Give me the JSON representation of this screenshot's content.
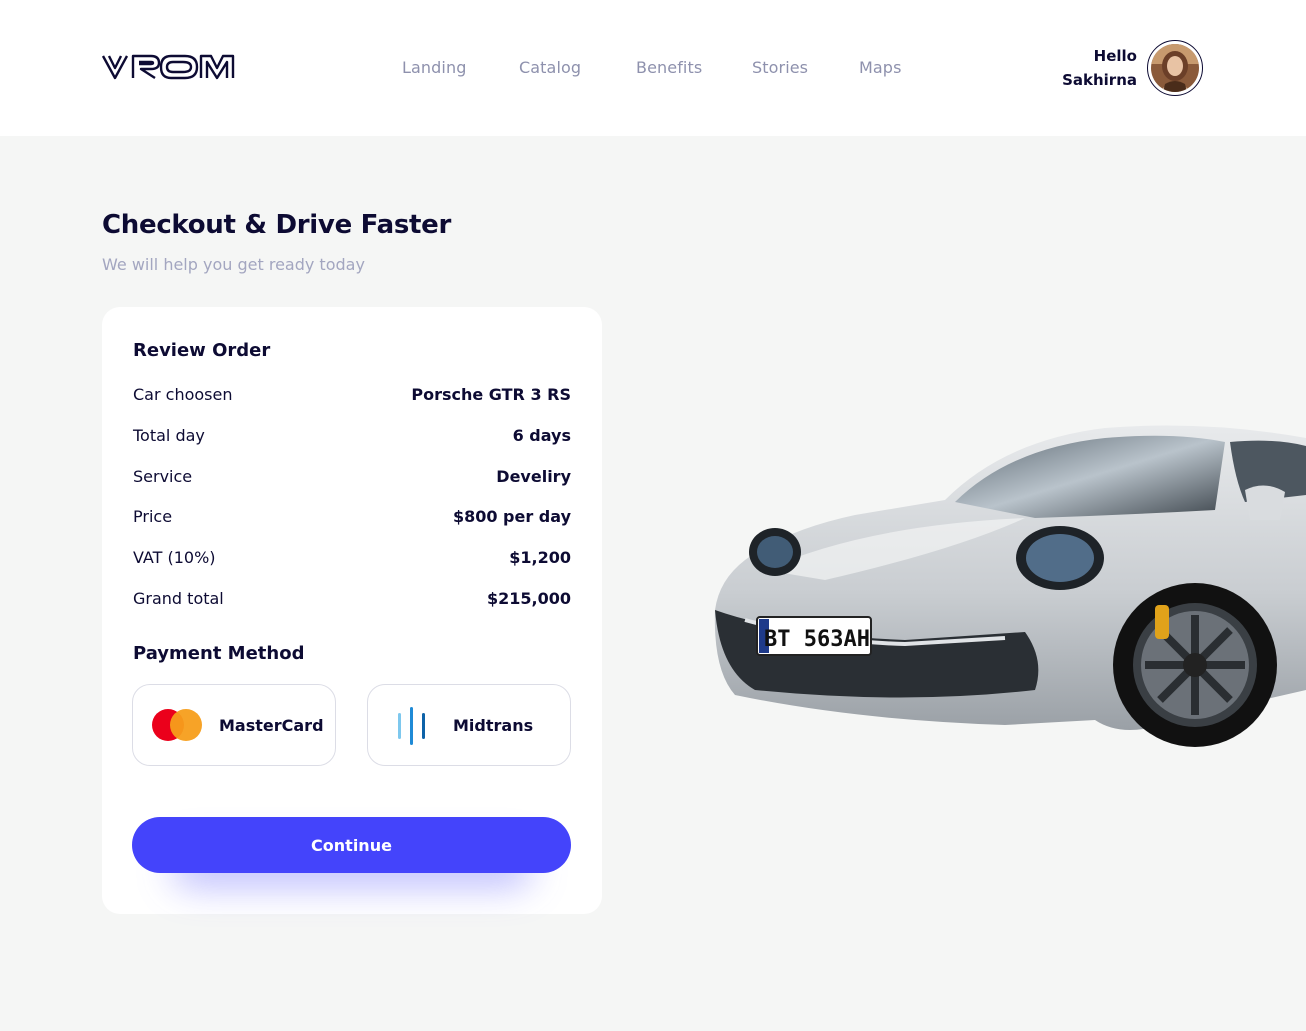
{
  "header": {
    "logo": "VROM",
    "nav": [
      {
        "label": "Landing"
      },
      {
        "label": "Catalog"
      },
      {
        "label": "Benefits"
      },
      {
        "label": "Stories"
      },
      {
        "label": "Maps"
      }
    ],
    "user": {
      "greeting": "Hello",
      "name": "Sakhirna"
    }
  },
  "page": {
    "title": "Checkout & Drive Faster",
    "subtitle": "We will help you get ready today"
  },
  "review": {
    "title": "Review Order",
    "rows": [
      {
        "label": "Car choosen",
        "value": "Porsche GTR 3 RS"
      },
      {
        "label": "Total day",
        "value": "6 days"
      },
      {
        "label": "Service",
        "value": "Develiry"
      },
      {
        "label": "Price",
        "value": "$800 per day"
      },
      {
        "label": "VAT (10%)",
        "value": "$1,200"
      },
      {
        "label": "Grand total",
        "value": "$215,000"
      }
    ]
  },
  "payment": {
    "title": "Payment Method",
    "methods": [
      {
        "label": "MasterCard",
        "icon": "mastercard-icon"
      },
      {
        "label": "Midtrans",
        "icon": "midtrans-icon"
      }
    ]
  },
  "continue_label": "Continue",
  "car_plate": "BT 563AH",
  "colors": {
    "primary": "#4444fb",
    "dark": "#0d0b33",
    "muted": "#8e91ad",
    "background": "#f5f6f5"
  }
}
